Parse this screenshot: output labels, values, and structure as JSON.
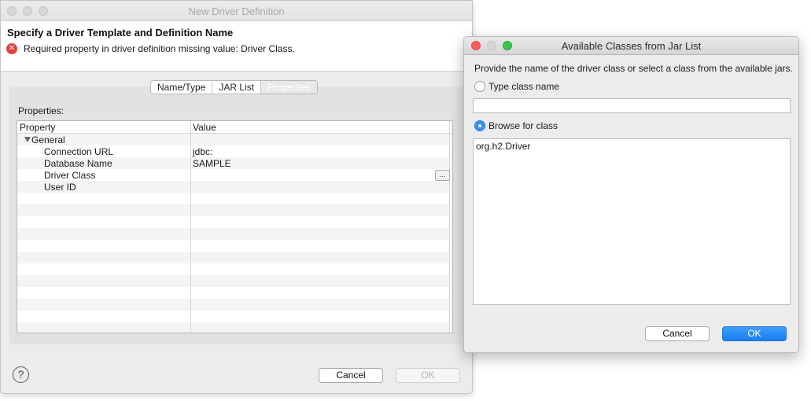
{
  "driver_window": {
    "title": "New Driver Definition",
    "header_title": "Specify a Driver Template and Definition Name",
    "error_message": "Required property in driver definition missing value: Driver Class.",
    "tabs": [
      {
        "label": "Name/Type",
        "active": false
      },
      {
        "label": "JAR List",
        "active": false
      },
      {
        "label": "Properties",
        "active": true
      }
    ],
    "properties_label": "Properties:",
    "table": {
      "columns": [
        "Property",
        "Value"
      ],
      "group": "General",
      "rows": [
        {
          "name": "Connection URL",
          "value": "jdbc:"
        },
        {
          "name": "Database Name",
          "value": "SAMPLE"
        },
        {
          "name": "Driver Class",
          "value": ""
        },
        {
          "name": "User ID",
          "value": ""
        }
      ],
      "ellipsis_label": "..."
    },
    "help_label": "?",
    "cancel_label": "Cancel",
    "ok_label": "OK"
  },
  "class_dialog": {
    "title": "Available Classes from Jar List",
    "instruction": "Provide the name of the driver class or select a class from the available jars.",
    "type_option": {
      "label": "Type class name",
      "selected": false
    },
    "type_input_value": "",
    "browse_option": {
      "label": "Browse for class",
      "selected": true
    },
    "classes": [
      "org.h2.Driver"
    ],
    "cancel_label": "Cancel",
    "ok_label": "OK"
  },
  "colors": {
    "primary_button": "#1a7ef2",
    "error_icon": "#e0443e",
    "close_traffic_light": "#fc605c",
    "minimize_traffic_light": "#fdbc40",
    "zoom_traffic_light": "#34c84a"
  }
}
